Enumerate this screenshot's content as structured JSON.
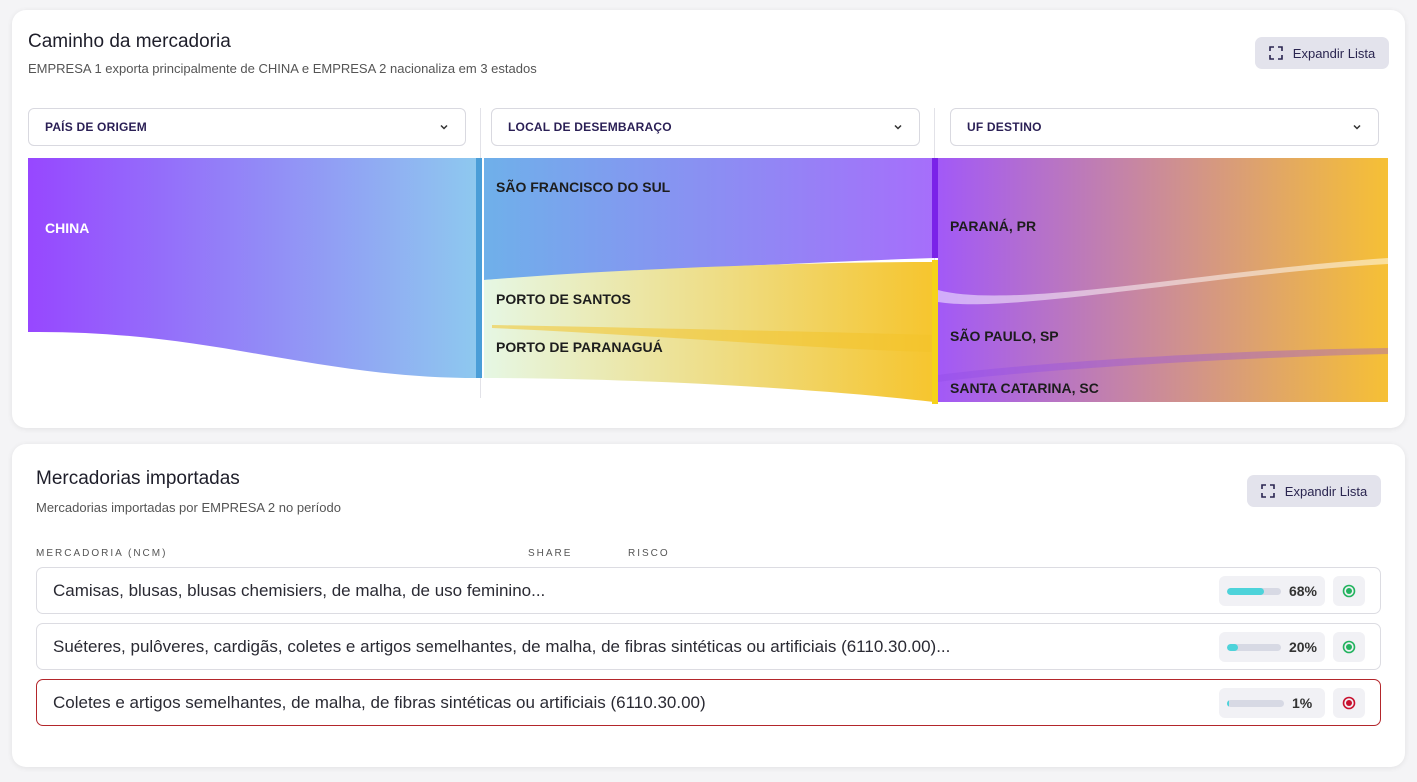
{
  "flow": {
    "title": "Caminho da mercadoria",
    "subtitle": "EMPRESA 1 exporta principalmente de CHINA e EMPRESA 2 nacionaliza em 3 estados",
    "expand_label": "Expandir Lista",
    "dropdowns": [
      "PAÍS DE ORIGEM",
      "LOCAL DE DESEMBARAÇO",
      "UF DESTINO"
    ],
    "origin_nodes": [
      "CHINA"
    ],
    "port_nodes": [
      "SÃO FRANCISCO DO SUL",
      "PORTO DE SANTOS",
      "PORTO DE PARANAGUÁ"
    ],
    "state_nodes": [
      "PARANÁ, PR",
      "SÃO PAULO, SP",
      "SANTA CATARINA, SC"
    ]
  },
  "goods": {
    "title": "Mercadorias importadas",
    "subtitle": "Mercadorias importadas por EMPRESA 2 no período",
    "expand_label": "Expandir Lista",
    "columns": [
      "MERCADORIA (NCM)",
      "SHARE",
      "RISCO"
    ],
    "rows": [
      {
        "label": "Camisas, blusas, blusas chemisiers, de malha, de uso feminino...",
        "share": 68,
        "share_label": "68%",
        "risk": "low"
      },
      {
        "label": "Suéteres, pulôveres, cardigãs, coletes e artigos semelhantes, de malha, de fibras sintéticas ou artificiais (6110.30.00)...",
        "share": 20,
        "share_label": "20%",
        "risk": "low"
      },
      {
        "label": "Coletes e artigos semelhantes, de malha, de fibras sintéticas ou artificiais (6110.30.00)",
        "share": 1,
        "share_label": "1%",
        "risk": "high"
      }
    ]
  },
  "colors": {
    "purple": "#9747ff",
    "blue": "#8ec9ef",
    "yellow": "#f6c52e",
    "risk_low": "#22b35e",
    "risk_high": "#c8102e",
    "bar": "#4dd3da"
  }
}
